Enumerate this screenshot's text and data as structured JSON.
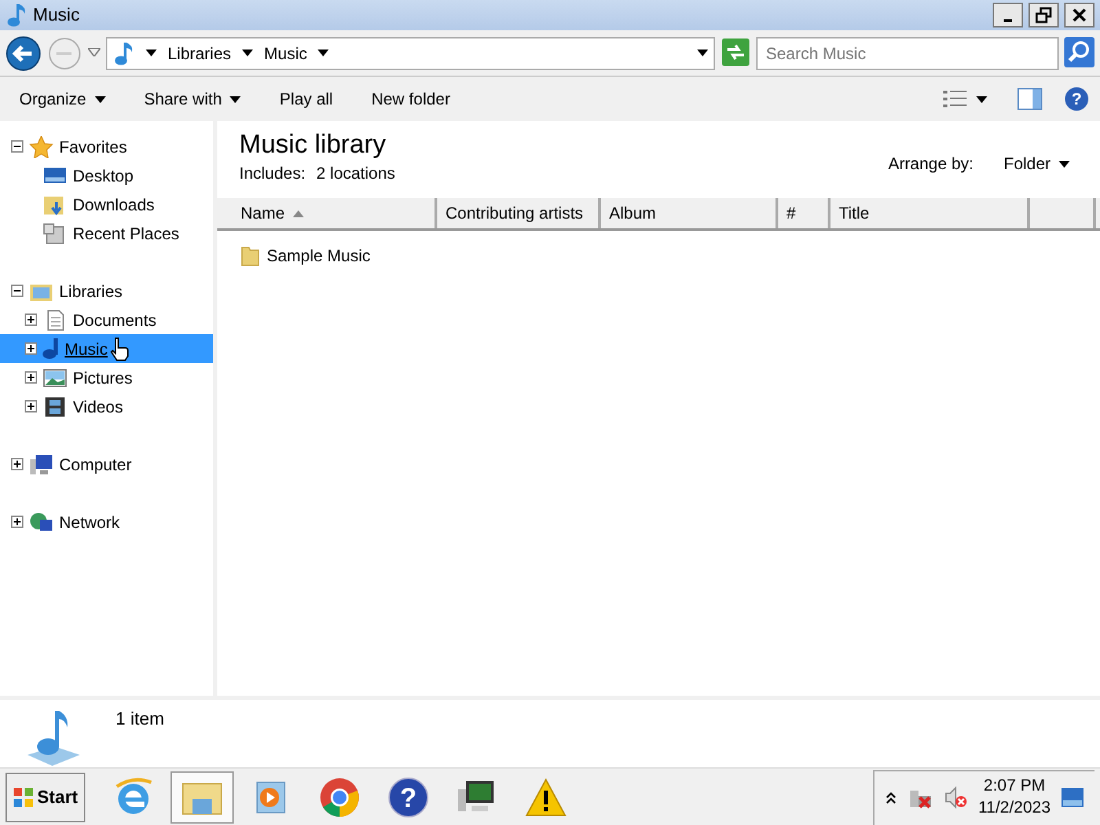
{
  "window": {
    "title": "Music"
  },
  "address_bar": {
    "path": [
      "Libraries",
      "Music"
    ]
  },
  "search": {
    "placeholder": "Search Music"
  },
  "help_button": {
    "glyph": "?"
  },
  "toolbar": [
    {
      "label": "Organize",
      "dropdown": true
    },
    {
      "label": "Share with",
      "dropdown": true
    },
    {
      "label": "Play all",
      "dropdown": false
    },
    {
      "label": "New folder",
      "dropdown": false
    }
  ],
  "navigation": [
    {
      "label": "Favorites",
      "kind": "star",
      "expanded": true,
      "selected": false,
      "children": [
        {
          "label": "Desktop",
          "kind": "desktop",
          "selected": false
        },
        {
          "label": "Downloads",
          "kind": "downloads",
          "selected": false
        },
        {
          "label": "Recent Places",
          "kind": "recent",
          "selected": false
        }
      ]
    },
    {
      "label": "Libraries",
      "kind": "libraries",
      "expanded": true,
      "selected": false,
      "children": [
        {
          "label": "Documents",
          "kind": "documents",
          "expanded": false,
          "selected": false
        },
        {
          "label": "Music",
          "kind": "music",
          "expanded": false,
          "selected": true
        },
        {
          "label": "Pictures",
          "kind": "pictures",
          "expanded": false,
          "selected": false
        },
        {
          "label": "Videos",
          "kind": "videos",
          "expanded": false,
          "selected": false
        }
      ]
    },
    {
      "label": "Computer",
      "kind": "computer",
      "expanded": false,
      "selected": false
    },
    {
      "label": "Network",
      "kind": "network",
      "expanded": false,
      "selected": false
    }
  ],
  "library": {
    "title": "Music library",
    "includes_label": "Includes:",
    "includes_value": "2 locations",
    "arrange_label": "Arrange by:",
    "arrange_value": "Folder"
  },
  "table": {
    "columns": [
      {
        "label": "Name",
        "sorted": true
      },
      {
        "label": "Contributing artists",
        "sorted": false
      },
      {
        "label": "Album",
        "sorted": false
      },
      {
        "label": "#",
        "sorted": false
      },
      {
        "label": "Title",
        "sorted": false
      }
    ],
    "rows": [
      {
        "name": "Sample Music"
      }
    ]
  },
  "details": {
    "count": "1 item"
  },
  "taskbar": {
    "start": "Start",
    "apps": [
      {
        "kind": "ie",
        "selected": false
      },
      {
        "kind": "explorer",
        "selected": true
      },
      {
        "kind": "media",
        "selected": false
      },
      {
        "kind": "chrome",
        "selected": false
      },
      {
        "kind": "help",
        "selected": false,
        "glyph": "?"
      },
      {
        "kind": "monitor",
        "selected": false
      },
      {
        "kind": "warning",
        "selected": false
      }
    ],
    "clock": {
      "time": "2:07 PM",
      "date": "11/2/2023"
    }
  }
}
